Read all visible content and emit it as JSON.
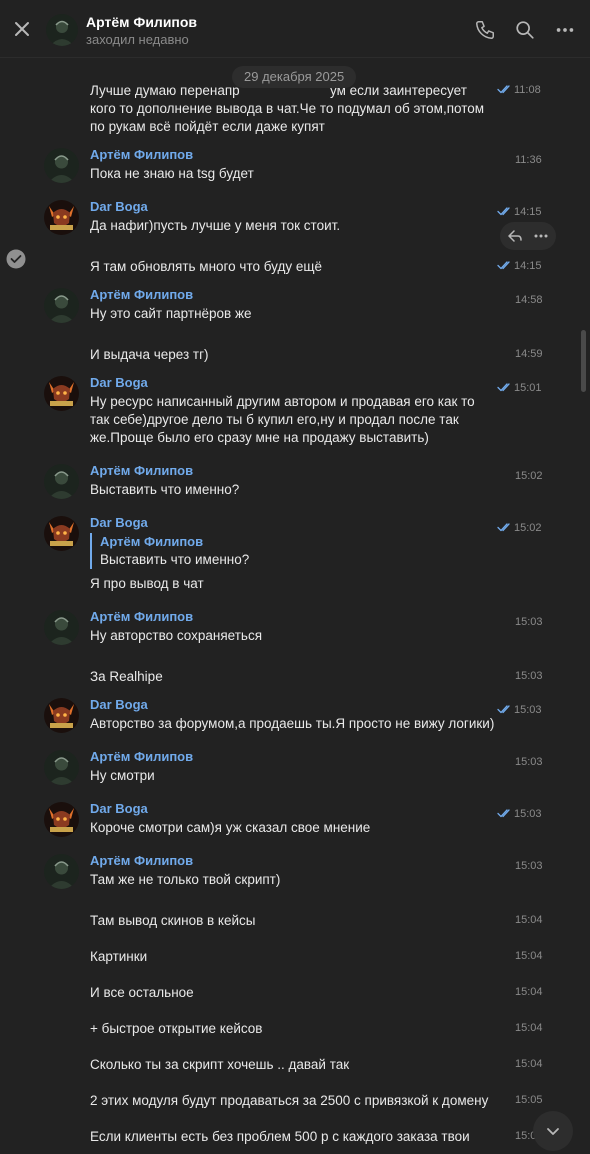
{
  "header": {
    "name": "Артём Филипов",
    "status": "заходил недавно"
  },
  "date_badge": "29 декабря 2025",
  "colors": {
    "background": "#222222",
    "accent": "#71aaeb",
    "text": "#e9e9e9",
    "muted": "#8a8a8a"
  },
  "messages": [
    {
      "id": "m0",
      "lines": [
        "Лучше думаю перенапр",
        "ум если заинтересует",
        "кого то дополнение вывода в чат.Че то подумал об этом,потом",
        "по рукам всё пойдёт если даже купят"
      ],
      "time": "11:08"
    },
    {
      "id": "m1",
      "author": "Артём Филипов",
      "lines": [
        "Пока не знаю на tsg будет"
      ],
      "time": "11:36"
    },
    {
      "id": "m2",
      "author": "Dar Boga",
      "lines": [
        "Да нафиг)пусть лучше у меня ток стоит."
      ],
      "time": "14:15"
    },
    {
      "id": "m3",
      "lines": [
        "Я там обновлять много что буду ещё"
      ],
      "time": "14:15"
    },
    {
      "id": "m4",
      "author": "Артём Филипов",
      "lines": [
        "Ну это сайт партнёров же"
      ],
      "time": "14:58"
    },
    {
      "id": "m5",
      "lines": [
        "И выдача через тг)"
      ],
      "time": "14:59"
    },
    {
      "id": "m6",
      "author": "Dar Boga",
      "lines": [
        "Ну ресурс написанный другим автором и продавая его как то",
        "так себе)другое дело ты б купил его,ну и продал после так",
        "же.Проще было его сразу мне на продажу выставить)"
      ],
      "time": "15:01"
    },
    {
      "id": "m7",
      "author": "Артём Филипов",
      "lines": [
        "Выставить что именно?"
      ],
      "time": "15:02"
    },
    {
      "id": "m8",
      "author": "Dar Boga",
      "quote": {
        "author": "Артём Филипов",
        "text": "Выставить что именно?"
      },
      "lines": [
        "Я про вывод в чат"
      ],
      "time": "15:02"
    },
    {
      "id": "m9",
      "author": "Артём Филипов",
      "lines": [
        "Ну авторство сохраняеться"
      ],
      "time": "15:03"
    },
    {
      "id": "m10",
      "lines": [
        "За Realhipe"
      ],
      "time": "15:03"
    },
    {
      "id": "m11",
      "author": "Dar Boga",
      "lines": [
        "Авторство за форумом,а продаешь ты.Я просто не вижу логики)"
      ],
      "time": "15:03"
    },
    {
      "id": "m12",
      "author": "Артём Филипов",
      "lines": [
        "Ну смотри"
      ],
      "time": "15:03"
    },
    {
      "id": "m13",
      "author": "Dar Boga",
      "lines": [
        "Короче смотри сам)я уж сказал свое мнение"
      ],
      "time": "15:03"
    },
    {
      "id": "m14",
      "author": "Артём Филипов",
      "lines": [
        "Там же не только твой скрипт)"
      ],
      "time": "15:03"
    },
    {
      "id": "m15",
      "lines": [
        "Там вывод скинов в кейсы"
      ],
      "time": "15:04"
    },
    {
      "id": "m16",
      "lines": [
        "Картинки"
      ],
      "time": "15:04"
    },
    {
      "id": "m17",
      "lines": [
        "И все остальное"
      ],
      "time": "15:04"
    },
    {
      "id": "m18",
      "lines": [
        "+ быстрое открытие кейсов"
      ],
      "time": "15:04"
    },
    {
      "id": "m19",
      "lines": [
        "Сколько ты за скрипт хочешь .. давай так"
      ],
      "time": "15:04"
    },
    {
      "id": "m20",
      "lines": [
        "2 этих модуля будут продаваться за 2500 с привязкой к домену"
      ],
      "time": "15:05"
    },
    {
      "id": "m21",
      "lines": [
        "Если клиенты есть без проблем 500 р с каждого заказа твои"
      ],
      "time": "15:0"
    }
  ]
}
